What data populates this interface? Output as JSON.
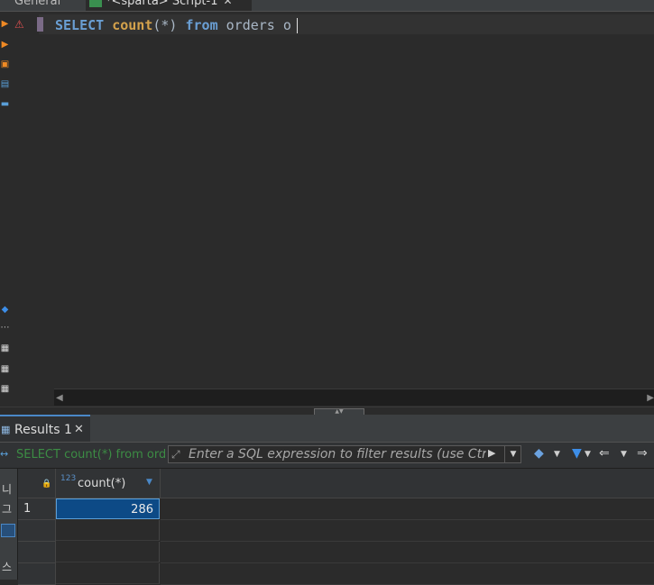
{
  "tabs": {
    "general": "General",
    "script": "*<sparta> Script-1",
    "close": "✕"
  },
  "editor": {
    "sql_keyword_select": "SELECT",
    "sql_function": "count",
    "sql_args": "(*)",
    "sql_keyword_from": "from",
    "sql_rest": "orders o"
  },
  "results": {
    "tab_label": "Results 1",
    "tab_close": "✕",
    "filter_sql": "SELECT count(*) from ord",
    "filter_placeholder": "Enter a SQL expression to filter results (use Ctrl+Space)",
    "columns": [
      {
        "type_badge": "123",
        "name": "count(*)"
      }
    ],
    "rows": [
      {
        "num": "1",
        "value": "286"
      },
      {
        "num": "",
        "value": ""
      },
      {
        "num": "",
        "value": ""
      },
      {
        "num": "",
        "value": ""
      }
    ]
  },
  "side_strip": {
    "label_top": "그",
    "label_mid": "니",
    "label_bottom": "스"
  },
  "colors": {
    "accent": "#4a88c7",
    "selected_cell": "#0d4a86",
    "keyword": "#6a9fd4",
    "function": "#d4a24c",
    "sql_preview": "#3c8c44"
  },
  "icons": {
    "warning": "warning-icon",
    "filter": "funnel-icon",
    "eraser": "eraser-icon",
    "back": "arrow-left-icon",
    "forward": "arrow-right-icon"
  }
}
